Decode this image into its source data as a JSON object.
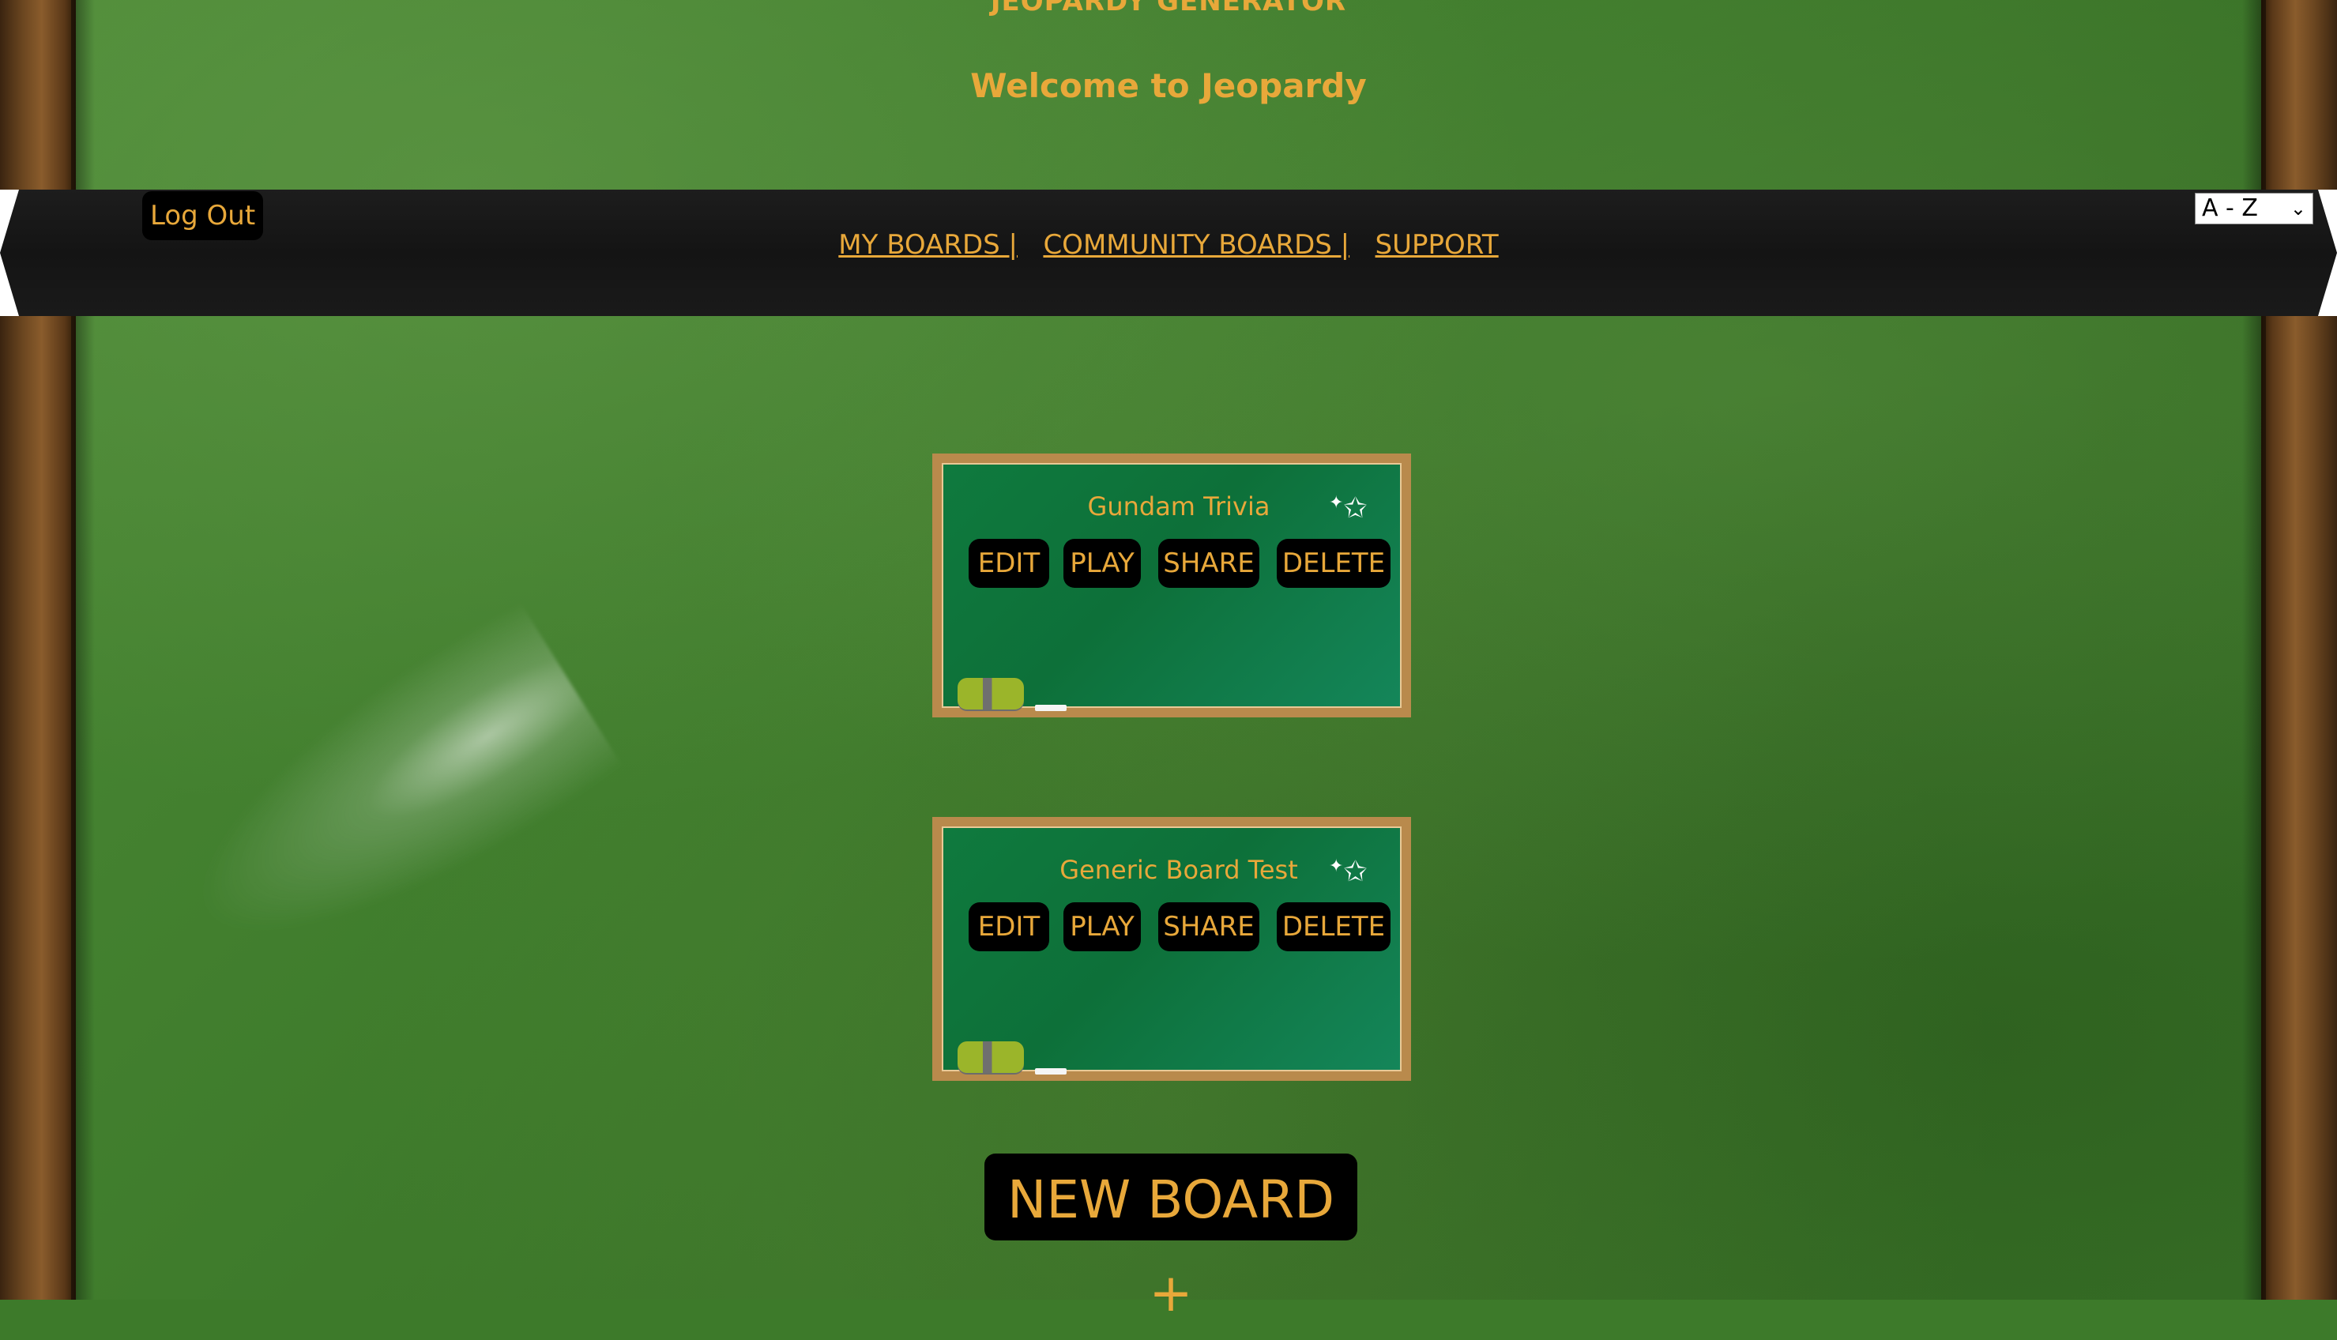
{
  "header": {
    "site_title": "JEOPARDY GENERATOR",
    "welcome": "Welcome to Jeopardy"
  },
  "nav": {
    "logout_label": "Log Out",
    "links": [
      {
        "label": "MY BOARDS |"
      },
      {
        "label": "COMMUNITY BOARDS |"
      },
      {
        "label": "SUPPORT"
      }
    ],
    "sort_selected": "A - Z"
  },
  "boards": [
    {
      "title": "Gundam Trivia",
      "edit_label": "EDIT",
      "play_label": "PLAY",
      "share_label": "SHARE",
      "delete_label": "DELETE"
    },
    {
      "title": "Generic Board Test",
      "edit_label": "EDIT",
      "play_label": "PLAY",
      "share_label": "SHARE",
      "delete_label": "DELETE"
    }
  ],
  "new_board_label": "NEW BOARD +",
  "colors": {
    "accent": "#e8a83a",
    "chalkboard": "#3f7c2c",
    "navbar": "#141414",
    "card_frame": "#b98a4c"
  },
  "icons": {
    "sort_dropdown": "chevron-down-icon",
    "card_decoration": "star-icon",
    "eraser": "eraser-icon"
  }
}
